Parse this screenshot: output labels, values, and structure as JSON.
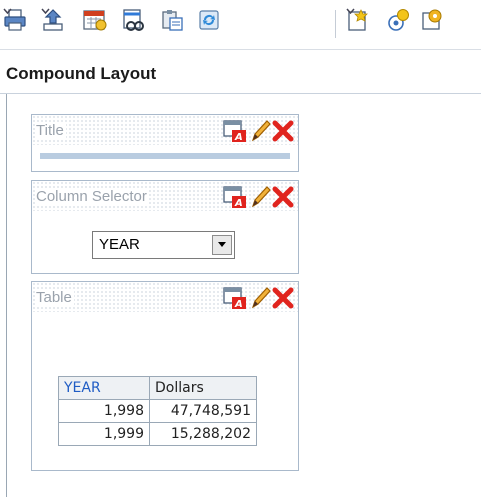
{
  "toolbar": {
    "buttons": [
      {
        "name": "print-icon",
        "color": "#3a66b5",
        "has_dropdown": true
      },
      {
        "name": "export-icon",
        "color": "#3a66b5",
        "has_dropdown": true
      },
      {
        "name": "schedule-icon",
        "color": "#d04020",
        "has_dropdown": false
      },
      {
        "name": "report-links-icon",
        "color": "#2f7ad8",
        "has_dropdown": false
      },
      {
        "name": "copy-paste-icon",
        "color": "#7a8fa3",
        "has_dropdown": false
      },
      {
        "name": "refresh-icon",
        "color": "#3a8fd8",
        "has_dropdown": false
      },
      {
        "name": "new-view-icon",
        "color": "#e6b400",
        "has_dropdown": true
      },
      {
        "name": "view-selector-icon",
        "color": "#e0a000",
        "has_dropdown": false
      },
      {
        "name": "properties-icon",
        "color": "#d08a00",
        "has_dropdown": false
      }
    ]
  },
  "section": {
    "title": "Compound Layout"
  },
  "views": {
    "title": {
      "label": "Title"
    },
    "column_selector": {
      "label": "Column Selector",
      "selected": "YEAR"
    },
    "table": {
      "label": "Table",
      "columns": [
        "YEAR",
        "Dollars"
      ],
      "rows": [
        [
          "1,998",
          "47,748,591"
        ],
        [
          "1,999",
          "15,288,202"
        ]
      ]
    }
  },
  "colors": {
    "accent_blue": "#1f5cc4",
    "delete_red": "#e0241e",
    "title_bar": "#b9cce0"
  }
}
